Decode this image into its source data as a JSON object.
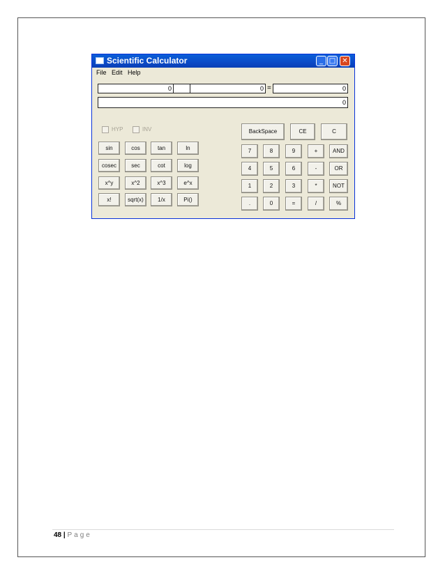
{
  "window": {
    "title": "Scientific Calculator",
    "controls": {
      "minimize": "_",
      "maximize": "□",
      "close": "✕"
    }
  },
  "menu": [
    "File",
    "Edit",
    "Help"
  ],
  "display": {
    "operand1": "0",
    "operand2": "0",
    "equals_sign": "=",
    "result": "0",
    "main": "0"
  },
  "checkboxes": {
    "hyp": "HYP",
    "inv": "INV"
  },
  "sci_buttons": [
    [
      "sin",
      "cos",
      "tan",
      "ln"
    ],
    [
      "cosec",
      "sec",
      "cot",
      "log"
    ],
    [
      "x^y",
      "x^2",
      "x^3",
      "e^x"
    ],
    [
      "x!",
      "sqrt(x)",
      "1/x",
      "Pi()"
    ]
  ],
  "top_buttons": [
    "BackSpace",
    "CE",
    "C"
  ],
  "num_buttons": [
    [
      "7",
      "8",
      "9",
      "+",
      "AND"
    ],
    [
      "4",
      "5",
      "6",
      "-",
      "OR"
    ],
    [
      "1",
      "2",
      "3",
      "*",
      "NOT"
    ],
    [
      ".",
      "0",
      "=",
      "/",
      "%"
    ]
  ],
  "footer": {
    "page_number": "48",
    "separator": "|",
    "page_label": "Page"
  }
}
